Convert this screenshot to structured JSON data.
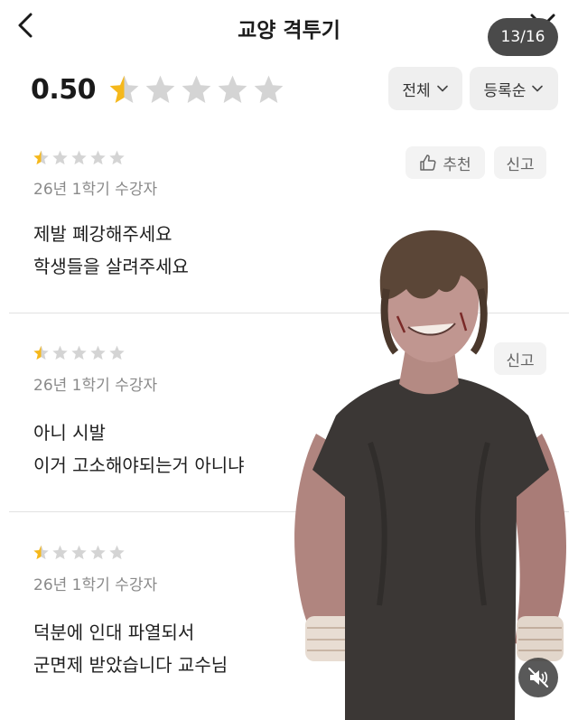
{
  "header": {
    "title": "교양 격투기",
    "page_indicator": "13/16"
  },
  "rating": {
    "score": "0.50",
    "value_out_of_5": 0.5
  },
  "filters": {
    "scope_label": "전체",
    "order_label": "등록순"
  },
  "colors": {
    "star_filled": "#f5b81c",
    "star_empty": "#d4d4d4",
    "meta_text": "#8a8a8a"
  },
  "reviews": [
    {
      "stars": 0.5,
      "meta": "26년 1학기 수강자",
      "lines": [
        "제발 폐강해주세요",
        "학생들을 살려주세요"
      ],
      "recommend_label": "추천",
      "report_label": "신고"
    },
    {
      "stars": 0.5,
      "meta": "26년 1학기 수강자",
      "lines": [
        "아니 시발",
        "이거 고소해야되는거 아니냐"
      ],
      "report_label": "신고"
    },
    {
      "stars": 0.5,
      "meta": "26년 1학기 수강자",
      "lines": [
        "덕분에 인대 파열되서",
        "군면제 받았습니다 교수님"
      ]
    }
  ],
  "icons": {
    "back": "back-chevron-icon",
    "close": "close-icon",
    "thumbs_up": "thumbs-up-icon",
    "mute": "speaker-muted-icon",
    "dropdown": "chevron-down-icon"
  }
}
